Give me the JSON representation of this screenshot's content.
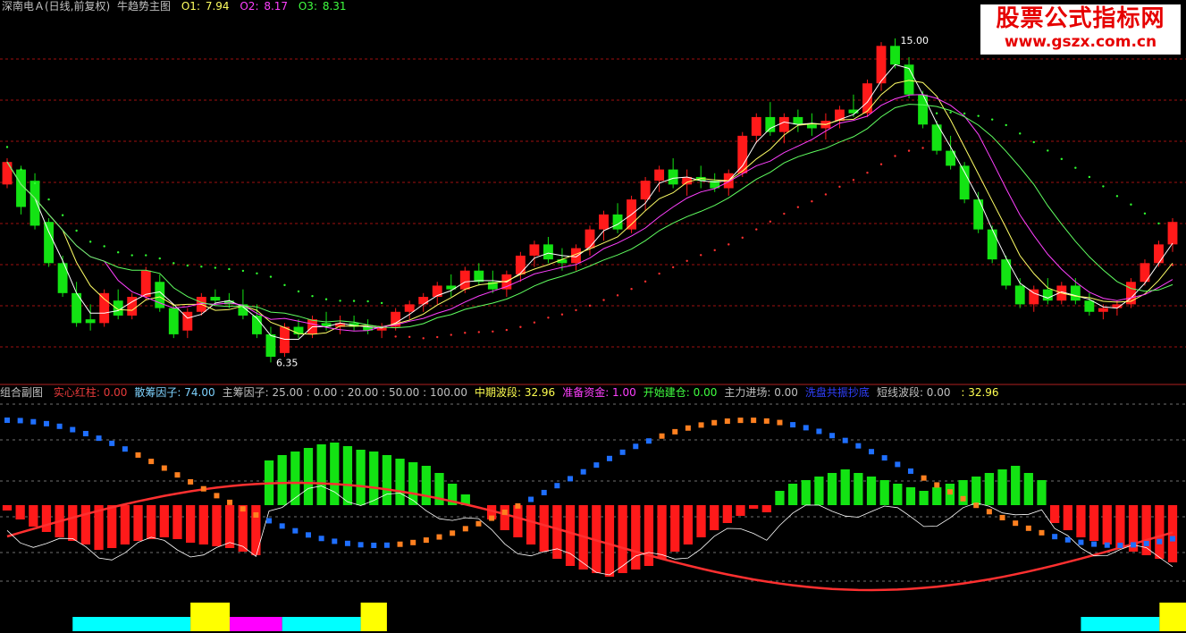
{
  "main_panel": {
    "header": {
      "symbol": "深南电Ａ(日线,前复权)",
      "indicator": "牛趋势主图",
      "o1_label": "O1:",
      "o1_value": "7.94",
      "o2_label": "O2:",
      "o2_value": "8.17",
      "o3_label": "O3:",
      "o3_value": "8.31"
    },
    "annotations": {
      "high": "15.00",
      "low": "6.35"
    }
  },
  "sub_panel": {
    "header": {
      "title": "组合副图",
      "items": [
        {
          "label": "实心红柱:",
          "value": "0.00",
          "color": "#e83a3a"
        },
        {
          "label": "散筹因子:",
          "value": "74.00",
          "color": "#7fd3ff"
        },
        {
          "label": "主筹因子:",
          "value": "25.00 : 0.00 : 20.00 : 50.00 : 100.00",
          "color": "#c0c0c0"
        },
        {
          "label": "中期波段:",
          "value": "32.96",
          "color": "#ffff50"
        },
        {
          "label": "准备资金:",
          "value": "1.00",
          "color": "#ff40ff"
        },
        {
          "label": "开始建仓:",
          "value": "0.00",
          "color": "#40ff40"
        },
        {
          "label": "主力进场:",
          "value": "0.00",
          "color": "#c0c0c0"
        },
        {
          "label": "洗盘共振抄底",
          "value": "",
          "color": "#3040ff"
        },
        {
          "label": "短线波段:",
          "value": "0.00",
          "color": "#c0c0c0"
        },
        {
          "label": "",
          "value": ": 32.96",
          "color": "#ffff50"
        }
      ]
    }
  },
  "logo": {
    "line1": "股票公式指标网",
    "line2": "www.gszx.com.cn"
  },
  "colors": {
    "up": "#ff1a1a",
    "down": "#13e313",
    "grid": "#a01010",
    "ma_white": "#ffffff",
    "ma_yellow": "#ffff66",
    "ma_magenta": "#ff40ff",
    "ma_green": "#60ff60",
    "dots_red": "#ff3030",
    "dots_green": "#30ff30",
    "cyan_line": "#5ad6e6"
  },
  "chart_data": [
    {
      "type": "candlestick",
      "title": "牛趋势主图",
      "ylim": [
        6.0,
        15.5
      ],
      "ohlc": [
        [
          11.1,
          11.8,
          11.0,
          11.7
        ],
        [
          11.5,
          11.6,
          10.3,
          10.5
        ],
        [
          11.2,
          11.4,
          9.9,
          10.0
        ],
        [
          10.1,
          10.2,
          8.9,
          9.0
        ],
        [
          9.0,
          9.2,
          8.1,
          8.2
        ],
        [
          8.2,
          8.5,
          7.3,
          7.4
        ],
        [
          7.5,
          7.9,
          7.2,
          7.4
        ],
        [
          7.4,
          8.3,
          7.3,
          8.2
        ],
        [
          8.0,
          8.3,
          7.5,
          7.6
        ],
        [
          7.6,
          8.2,
          7.5,
          8.1
        ],
        [
          8.1,
          8.9,
          8.0,
          8.8
        ],
        [
          8.5,
          8.7,
          7.7,
          7.8
        ],
        [
          7.8,
          7.9,
          7.0,
          7.1
        ],
        [
          7.2,
          7.8,
          7.0,
          7.7
        ],
        [
          7.7,
          8.2,
          7.6,
          8.1
        ],
        [
          8.1,
          8.3,
          7.9,
          8.0
        ],
        [
          8.0,
          8.2,
          7.8,
          7.9
        ],
        [
          7.9,
          8.3,
          7.5,
          7.6
        ],
        [
          7.6,
          7.9,
          7.0,
          7.1
        ],
        [
          7.1,
          7.3,
          6.35,
          6.5
        ],
        [
          6.6,
          7.4,
          6.5,
          7.3
        ],
        [
          7.3,
          7.5,
          7.0,
          7.1
        ],
        [
          7.1,
          7.6,
          7.0,
          7.5
        ],
        [
          7.4,
          7.7,
          7.2,
          7.3
        ],
        [
          7.3,
          7.6,
          7.1,
          7.4
        ],
        [
          7.4,
          7.6,
          7.2,
          7.3
        ],
        [
          7.3,
          7.5,
          7.1,
          7.2
        ],
        [
          7.2,
          7.4,
          7.0,
          7.3
        ],
        [
          7.3,
          7.8,
          7.2,
          7.7
        ],
        [
          7.7,
          8.0,
          7.5,
          7.9
        ],
        [
          7.9,
          8.2,
          7.7,
          8.1
        ],
        [
          8.1,
          8.5,
          7.9,
          8.4
        ],
        [
          8.4,
          8.7,
          8.1,
          8.3
        ],
        [
          8.3,
          8.9,
          8.2,
          8.8
        ],
        [
          8.8,
          9.0,
          8.4,
          8.5
        ],
        [
          8.5,
          8.8,
          8.2,
          8.3
        ],
        [
          8.3,
          8.8,
          8.1,
          8.7
        ],
        [
          8.7,
          9.3,
          8.5,
          9.2
        ],
        [
          9.2,
          9.6,
          8.9,
          9.5
        ],
        [
          9.5,
          9.7,
          9.0,
          9.1
        ],
        [
          9.1,
          9.4,
          8.8,
          9.0
        ],
        [
          9.0,
          9.5,
          8.8,
          9.4
        ],
        [
          9.4,
          10.0,
          9.2,
          9.9
        ],
        [
          9.9,
          10.4,
          9.6,
          10.3
        ],
        [
          10.3,
          10.6,
          9.8,
          9.9
        ],
        [
          9.9,
          10.8,
          9.8,
          10.7
        ],
        [
          10.7,
          11.3,
          10.4,
          11.2
        ],
        [
          11.2,
          11.6,
          10.9,
          11.5
        ],
        [
          11.5,
          11.8,
          11.0,
          11.1
        ],
        [
          11.1,
          11.5,
          10.8,
          11.3
        ],
        [
          11.3,
          11.6,
          11.0,
          11.2
        ],
        [
          11.2,
          11.4,
          10.9,
          11.0
        ],
        [
          11.0,
          11.5,
          10.8,
          11.4
        ],
        [
          11.4,
          12.5,
          11.3,
          12.4
        ],
        [
          12.4,
          13.0,
          12.2,
          12.9
        ],
        [
          12.9,
          13.3,
          12.4,
          12.5
        ],
        [
          12.5,
          13.0,
          12.2,
          12.9
        ],
        [
          12.9,
          13.1,
          12.5,
          12.7
        ],
        [
          12.7,
          13.0,
          12.4,
          12.6
        ],
        [
          12.6,
          13.0,
          12.3,
          12.8
        ],
        [
          12.8,
          13.2,
          12.6,
          13.1
        ],
        [
          13.1,
          13.5,
          12.9,
          13.0
        ],
        [
          13.0,
          13.9,
          12.9,
          13.8
        ],
        [
          13.8,
          14.9,
          13.6,
          14.8
        ],
        [
          14.8,
          15.0,
          14.2,
          14.3
        ],
        [
          14.3,
          14.5,
          13.4,
          13.5
        ],
        [
          13.5,
          13.6,
          12.6,
          12.7
        ],
        [
          12.7,
          12.8,
          11.9,
          12.0
        ],
        [
          12.0,
          12.4,
          11.5,
          11.6
        ],
        [
          11.6,
          11.7,
          10.6,
          10.7
        ],
        [
          10.7,
          10.9,
          9.8,
          9.9
        ],
        [
          9.9,
          10.0,
          9.0,
          9.1
        ],
        [
          9.1,
          9.2,
          8.3,
          8.4
        ],
        [
          8.4,
          8.6,
          7.8,
          7.9
        ],
        [
          7.9,
          8.4,
          7.7,
          8.3
        ],
        [
          8.3,
          8.6,
          7.9,
          8.0
        ],
        [
          8.0,
          8.5,
          7.9,
          8.4
        ],
        [
          8.4,
          8.6,
          7.9,
          8.0
        ],
        [
          8.0,
          8.2,
          7.6,
          7.7
        ],
        [
          7.7,
          7.9,
          7.5,
          7.8
        ],
        [
          7.8,
          8.0,
          7.6,
          7.9
        ],
        [
          7.9,
          8.6,
          7.8,
          8.5
        ],
        [
          8.5,
          9.1,
          8.4,
          9.0
        ],
        [
          9.0,
          9.6,
          8.9,
          9.5
        ],
        [
          9.5,
          10.2,
          9.3,
          10.1
        ]
      ]
    },
    {
      "type": "bar",
      "title": "组合副图",
      "values": [
        -3,
        -8,
        -12,
        -15,
        -18,
        -20,
        -22,
        -25,
        -24,
        -22,
        -20,
        -19,
        -18,
        -19,
        -21,
        -22,
        -23,
        -24,
        -26,
        -28,
        25,
        28,
        30,
        32,
        34,
        35,
        33,
        31,
        30,
        28,
        26,
        24,
        22,
        18,
        12,
        6,
        0,
        -8,
        -14,
        -18,
        -22,
        -26,
        -30,
        -34,
        -36,
        -38,
        -40,
        -38,
        -36,
        -34,
        -30,
        -26,
        -22,
        -18,
        -14,
        -10,
        -6,
        -2,
        -4,
        8,
        12,
        14,
        16,
        18,
        20,
        18,
        16,
        14,
        12,
        10,
        8,
        10,
        12,
        14,
        16,
        18,
        20,
        22,
        18,
        14,
        -10,
        -14,
        -18,
        -20,
        -22,
        -24,
        -26,
        -28,
        -30,
        -32
      ],
      "bottom_bands": [
        {
          "from": 5,
          "to": 14,
          "color": "#00ffff"
        },
        {
          "from": 14,
          "to": 17,
          "color": "#ffff00"
        },
        {
          "from": 17,
          "to": 21,
          "color": "#ff00ff"
        },
        {
          "from": 21,
          "to": 27,
          "color": "#00ffff"
        },
        {
          "from": 27,
          "to": 29,
          "color": "#ffff00"
        },
        {
          "from": 82,
          "to": 88,
          "color": "#00ffff"
        },
        {
          "from": 88,
          "to": 93,
          "color": "#ffff00"
        },
        {
          "from": 93,
          "to": 98,
          "color": "#00ffff"
        }
      ]
    }
  ]
}
